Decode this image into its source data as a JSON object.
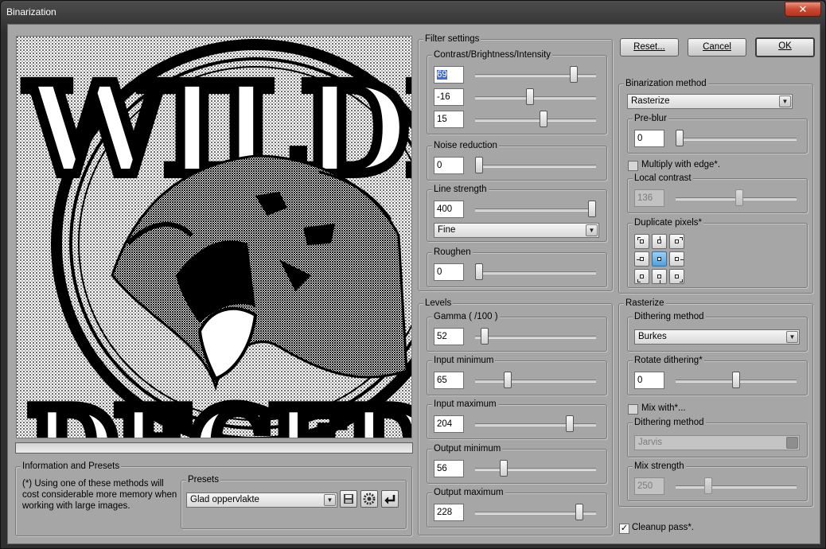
{
  "window": {
    "title": "Binarization",
    "close": "✕"
  },
  "buttons": {
    "reset": "Reset...",
    "cancel": "Cancel",
    "ok": "OK"
  },
  "filter_settings": {
    "title": "Filter settings",
    "contrast": {
      "title": "Contrast/Brightness/Intensity",
      "contrast_value": "69",
      "brightness_value": "-16",
      "intensity_value": "15",
      "contrast_level": 0.84,
      "brightness_level": 0.45,
      "intensity_level": 0.57
    },
    "noise": {
      "title": "Noise reduction",
      "value": "0",
      "level": 0.0
    },
    "line_strength": {
      "title": "Line strength",
      "value": "400",
      "level": 1.0,
      "mode": "Fine"
    },
    "roughen": {
      "title": "Roughen",
      "value": "0",
      "level": 0.0
    }
  },
  "levels": {
    "title": "Levels",
    "gamma": {
      "title": "Gamma ( /100 )",
      "value": "52",
      "level": 0.05
    },
    "input_min": {
      "title": "Input minimum",
      "value": "65",
      "level": 0.25
    },
    "input_max": {
      "title": "Input maximum",
      "value": "204",
      "level": 0.8
    },
    "output_min": {
      "title": "Output minimum",
      "value": "56",
      "level": 0.22
    },
    "output_max": {
      "title": "Output maximum",
      "value": "228",
      "level": 0.89
    }
  },
  "binarization": {
    "title": "Binarization method",
    "method": "Rasterize",
    "preblur": {
      "title": "Pre-blur",
      "value": "0",
      "level": 0.0
    },
    "multiply_edge": {
      "label": "Multiply with edge*.",
      "checked": false
    },
    "local_contrast": {
      "title": "Local contrast",
      "value": "136",
      "level": 0.53
    },
    "duplicate": {
      "title": "Duplicate pixels*"
    }
  },
  "rasterize": {
    "title": "Rasterize",
    "dithering": {
      "title": "Dithering method",
      "value": "Burkes"
    },
    "rotate": {
      "title": "Rotate dithering*",
      "value": "0",
      "level": 0.5
    },
    "mix_with": {
      "label": "Mix with*...",
      "checked": false
    },
    "dithering2": {
      "title": "Dithering method",
      "value": "Jarvis"
    },
    "mix_strength": {
      "title": "Mix strength",
      "value": "250",
      "level": 0.25
    }
  },
  "cleanup": {
    "label": "Cleanup pass*.",
    "checked": true,
    "mark": "✓"
  },
  "presets_panel": {
    "title": "Information and Presets",
    "info": "(*)  Using one of these methods will cost considerable more memory when working with large images.",
    "presets": {
      "title": "Presets",
      "value": "Glad oppervlakte"
    }
  },
  "preview": {
    "text_top": "WILDLI",
    "text_bottom": "DECEDVATIO"
  },
  "colors": {
    "window_bg": "#a6a6a6",
    "selection": "#3a6fd8",
    "active_duplicate": "#4aa1e3"
  },
  "icons": [
    "close-icon",
    "save-icon",
    "gear-icon",
    "enter-icon",
    "dropdown-arrow-icon",
    "checkmark-icon"
  ]
}
